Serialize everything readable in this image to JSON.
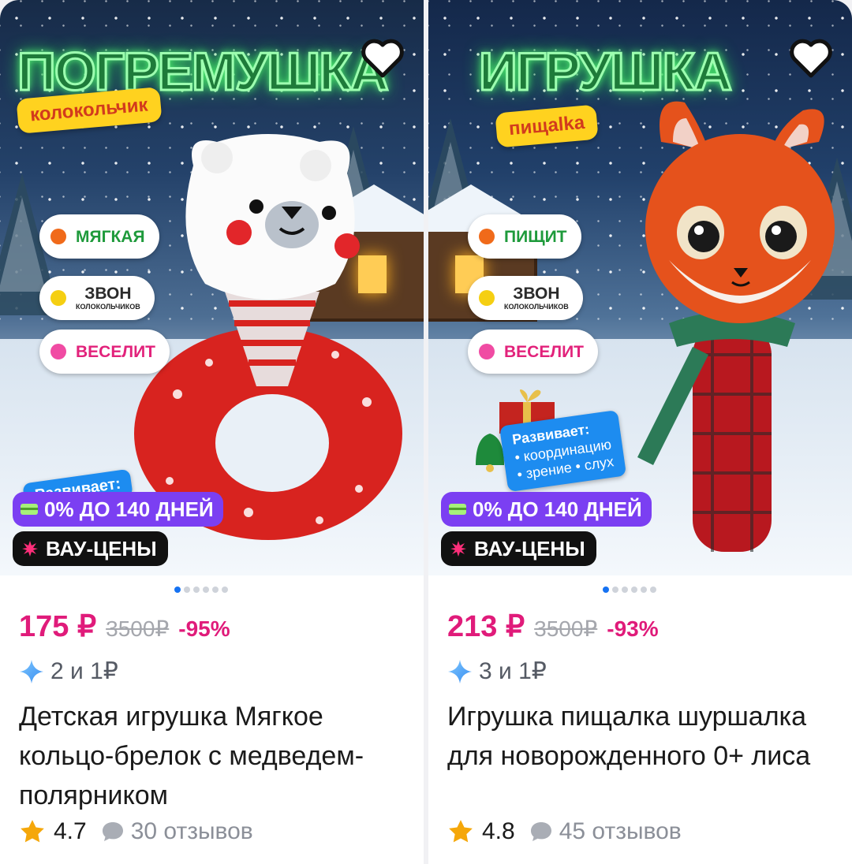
{
  "products": [
    {
      "banner_title": "ПОГРЕМУШКА",
      "banner_subtitle": "колокольчик",
      "features": [
        {
          "label": "МЯГКАЯ",
          "sub": "",
          "dot_color": "#f06a1a",
          "style": "green"
        },
        {
          "label": "ЗВОН",
          "sub": "КОЛОКОЛЬЧИКОВ",
          "dot_color": "#f5cf12",
          "style": "dark"
        },
        {
          "label": "ВЕСЕЛИТ",
          "sub": "",
          "dot_color": "#f04ba3",
          "style": "pink"
        }
      ],
      "develop_text": "Развивает:",
      "installment_badge": "0% ДО 140 ДНЕЙ",
      "promo_badge": "ВАУ-ЦЕНЫ",
      "price": "175 ₽",
      "old_price": "3500₽",
      "discount": "-95%",
      "bonus": "2 и 1₽",
      "title": "Детская игрушка Мягкое кольцо-брелок с медведем-полярником",
      "rating": "4.7",
      "reviews": "30 отзывов",
      "image_slide": 1,
      "image_slides_total": 6
    },
    {
      "banner_title": "ИГРУШКА",
      "banner_subtitle": "пищalka",
      "features": [
        {
          "label": "ПИЩИТ",
          "sub": "",
          "dot_color": "#f06a1a",
          "style": "green"
        },
        {
          "label": "ЗВОН",
          "sub": "КОЛОКОЛЬЧИКОВ",
          "dot_color": "#f5cf12",
          "style": "dark"
        },
        {
          "label": "ВЕСЕЛИТ",
          "sub": "",
          "dot_color": "#f04ba3",
          "style": "pink"
        }
      ],
      "develop_text": "Развивает:",
      "develop_items": "• координацию",
      "develop_items2": "• зрение • слух",
      "installment_badge": "0% ДО 140 ДНЕЙ",
      "promo_badge": "ВАУ-ЦЕНЫ",
      "price": "213 ₽",
      "old_price": "3500₽",
      "discount": "-93%",
      "bonus": "3 и 1₽",
      "title": "Игрушка пищалка шуршалка для новорожденного 0+ лиса",
      "rating": "4.8",
      "reviews": "45 отзывов",
      "image_slide": 1,
      "image_slides_total": 6
    }
  ],
  "colors": {
    "price": "#e01b7a",
    "installment": "#7b3ff2",
    "promo": "#111111",
    "dot_active": "#1672f2",
    "star": "#f5a70a"
  }
}
